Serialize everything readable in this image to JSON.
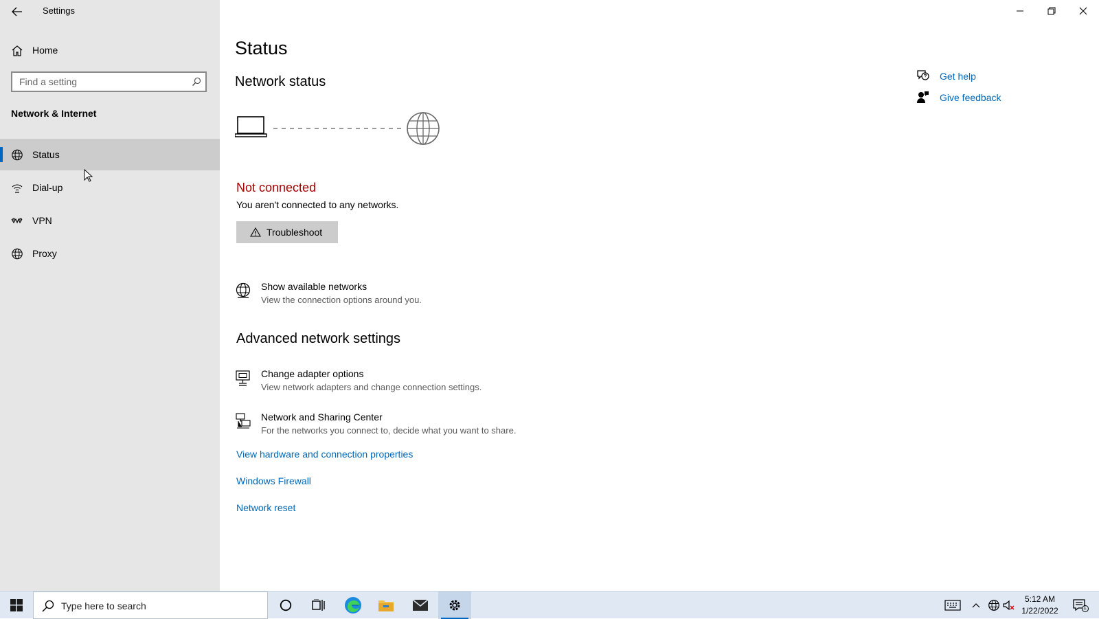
{
  "window": {
    "title": "Settings",
    "controls": [
      "minimize-icon",
      "restore-icon",
      "close-icon"
    ]
  },
  "sidebar": {
    "home_label": "Home",
    "search_placeholder": "Find a setting",
    "section_heading": "Network & Internet",
    "items": [
      {
        "label": "Status",
        "icon": "network-globe-icon",
        "selected": true
      },
      {
        "label": "Dial-up",
        "icon": "dialup-icon",
        "selected": false
      },
      {
        "label": "VPN",
        "icon": "vpn-icon",
        "selected": false
      },
      {
        "label": "Proxy",
        "icon": "globe-icon",
        "selected": false
      }
    ]
  },
  "main": {
    "title": "Status",
    "network_status_heading": "Network status",
    "status_title": "Not connected",
    "status_description": "You aren't connected to any networks.",
    "troubleshoot_label": "Troubleshoot",
    "show_networks": {
      "title": "Show available networks",
      "subtitle": "View the connection options around you."
    },
    "advanced_heading": "Advanced network settings",
    "adapter_options": {
      "title": "Change adapter options",
      "subtitle": "View network adapters and change connection settings."
    },
    "sharing_center": {
      "title": "Network and Sharing Center",
      "subtitle": "For the networks you connect to, decide what you want to share."
    },
    "links": [
      "View hardware and connection properties",
      "Windows Firewall",
      "Network reset"
    ]
  },
  "help": {
    "get_help": "Get help",
    "give_feedback": "Give feedback"
  },
  "taskbar": {
    "search_placeholder": "Type here to search",
    "time": "5:12 AM",
    "date": "1/22/2022",
    "notification_count": "1"
  },
  "colors": {
    "accent": "#0067c0",
    "link": "#0067b8",
    "error": "#a80000",
    "sidebar_bg": "#e6e6e6",
    "taskbar_bg": "#dfe8f3"
  }
}
